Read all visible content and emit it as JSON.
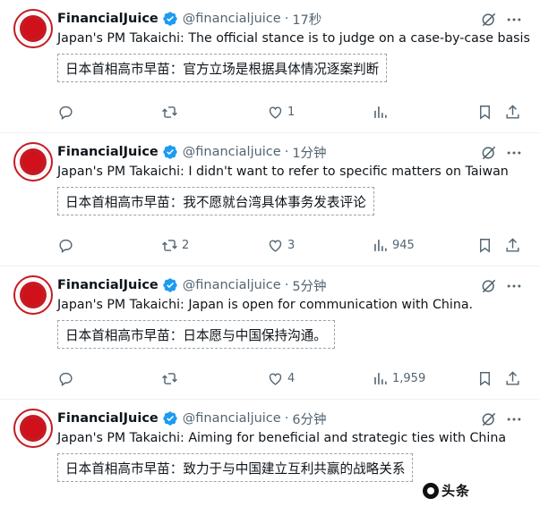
{
  "tweets": [
    {
      "name": "FinancialJuice",
      "handle": "@financialjuice",
      "separator": "·",
      "time": "17秒",
      "text": "Japan's PM Takaichi: The official stance is to judge on a case-by-case basis",
      "translation": "日本首相高市早苗：官方立场是根据具体情况逐案判断",
      "replies": "",
      "retweets": "",
      "likes": "1",
      "views": ""
    },
    {
      "name": "FinancialJuice",
      "handle": "@financialjuice",
      "separator": "·",
      "time": "1分钟",
      "text": "Japan's PM Takaichi: I didn't want to refer to specific matters on Taiwan",
      "translation": "日本首相高市早苗：我不愿就台湾具体事务发表评论",
      "replies": "",
      "retweets": "2",
      "likes": "3",
      "views": "945"
    },
    {
      "name": "FinancialJuice",
      "handle": "@financialjuice",
      "separator": "·",
      "time": "5分钟",
      "text": "Japan's PM Takaichi: Japan is open for communication with China.",
      "translation": "日本首相高市早苗：日本愿与中国保持沟通。",
      "replies": "",
      "retweets": "",
      "likes": "4",
      "views": "1,959"
    },
    {
      "name": "FinancialJuice",
      "handle": "@financialjuice",
      "separator": "·",
      "time": "6分钟",
      "text": "Japan's PM Takaichi: Aiming for beneficial and strategic ties with China",
      "translation": "日本首相高市早苗：致力于与中国建立互利共赢的战略关系",
      "replies": "",
      "retweets": "",
      "likes": "",
      "views": ""
    }
  ],
  "watermark": "头条",
  "icons": [
    "verified-icon",
    "grok-icon",
    "more-icon",
    "reply-icon",
    "retweet-icon",
    "like-icon",
    "views-icon",
    "bookmark-icon",
    "share-icon"
  ],
  "colors": {
    "text": "#0f1419",
    "secondary": "#536471",
    "verified": "#1d9bf0",
    "brand_red": "#c41b23",
    "divider": "#eff3f4"
  }
}
